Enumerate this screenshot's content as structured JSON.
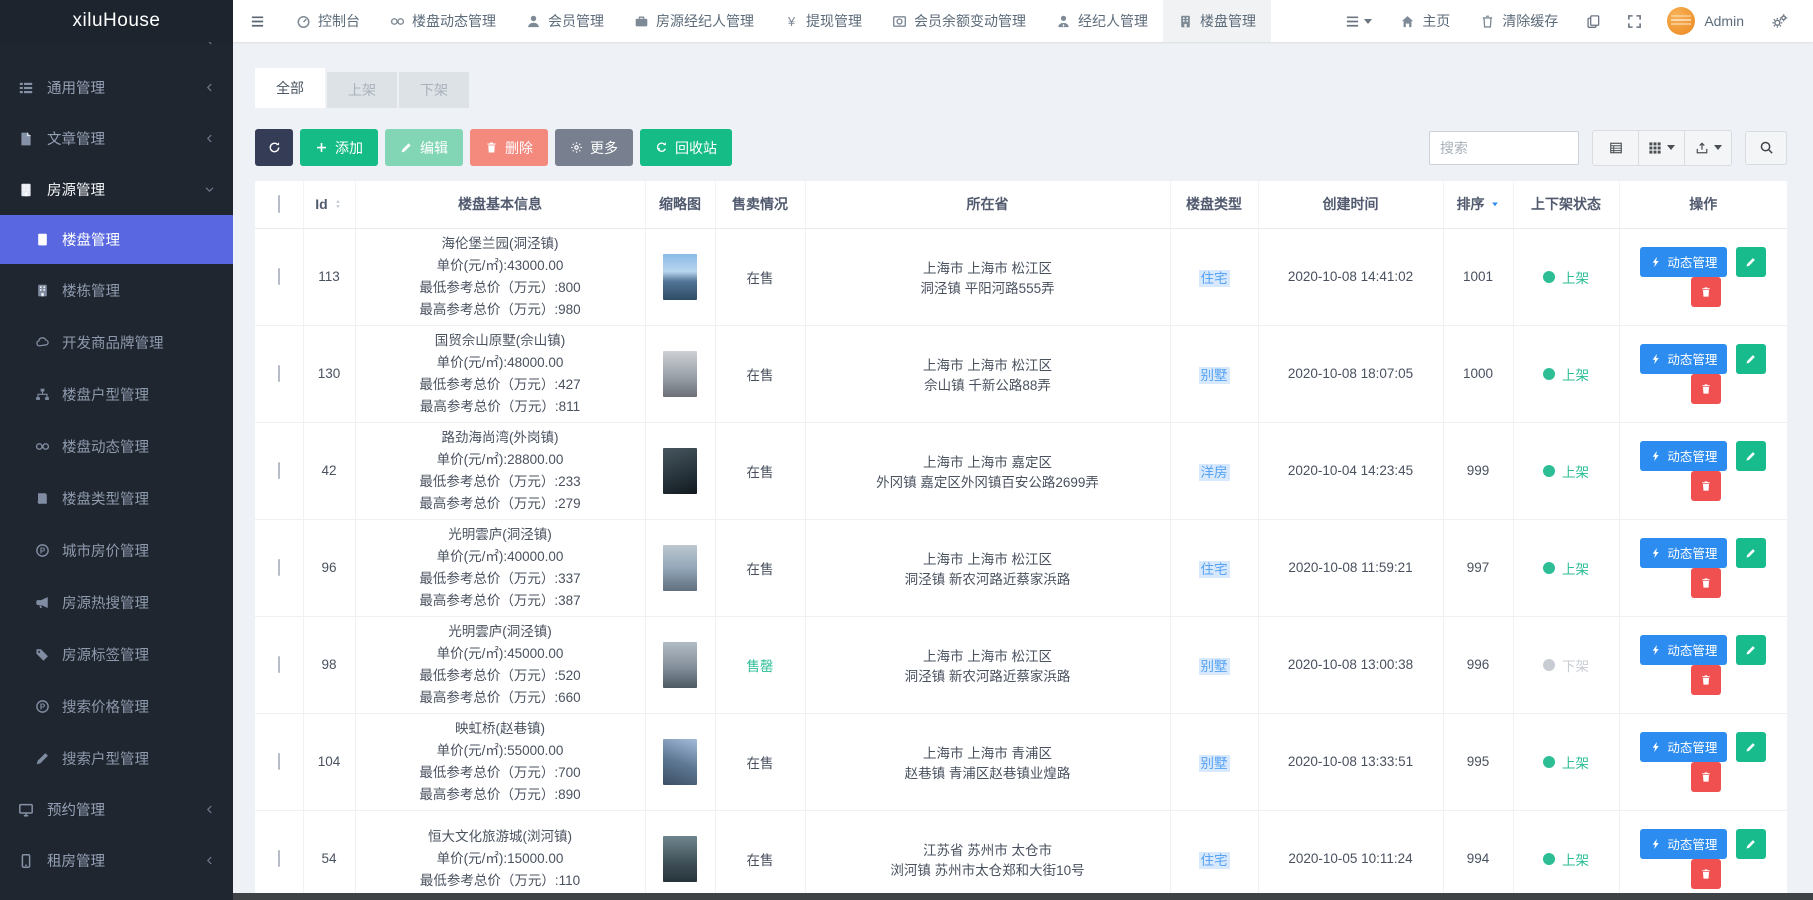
{
  "brand": "xiluHouse",
  "topnav": {
    "items": [
      {
        "label": "控制台",
        "icon": "gauge"
      },
      {
        "label": "楼盘动态管理",
        "icon": "binoc"
      },
      {
        "label": "会员管理",
        "icon": "user"
      },
      {
        "label": "房源经纪人管理",
        "icon": "briefcase"
      },
      {
        "label": "提现管理",
        "icon": "yen"
      },
      {
        "label": "会员余额变动管理",
        "icon": "balance"
      },
      {
        "label": "经纪人管理",
        "icon": "usertie"
      },
      {
        "label": "楼盘管理",
        "icon": "building",
        "active": true
      }
    ],
    "home_label": "主页",
    "clear_cache_label": "清除缓存",
    "admin_label": "Admin"
  },
  "sidebar": {
    "items": [
      {
        "label": "通用管理",
        "icon": "thlist",
        "type": "group"
      },
      {
        "label": "文章管理",
        "icon": "file",
        "type": "group"
      },
      {
        "label": "房源管理",
        "icon": "building",
        "type": "group",
        "expanded": true
      },
      {
        "label": "楼盘管理",
        "icon": "building",
        "type": "child",
        "active": true
      },
      {
        "label": "楼栋管理",
        "icon": "building",
        "type": "child"
      },
      {
        "label": "开发商品牌管理",
        "icon": "cloud",
        "type": "child"
      },
      {
        "label": "楼盘户型管理",
        "icon": "sitemap",
        "type": "child"
      },
      {
        "label": "楼盘动态管理",
        "icon": "binoc",
        "type": "child"
      },
      {
        "label": "楼盘类型管理",
        "icon": "book",
        "type": "child"
      },
      {
        "label": "城市房价管理",
        "icon": "pcircle",
        "type": "child"
      },
      {
        "label": "房源热搜管理",
        "icon": "bullhorn",
        "type": "child"
      },
      {
        "label": "房源标签管理",
        "icon": "tags",
        "type": "child"
      },
      {
        "label": "搜索价格管理",
        "icon": "pcircle",
        "type": "child"
      },
      {
        "label": "搜索户型管理",
        "icon": "pen",
        "type": "child"
      },
      {
        "label": "预约管理",
        "icon": "desktop",
        "type": "group"
      },
      {
        "label": "租房管理",
        "icon": "mobile",
        "type": "group"
      }
    ]
  },
  "tabs": [
    {
      "label": "全部",
      "active": true
    },
    {
      "label": "上架"
    },
    {
      "label": "下架"
    }
  ],
  "toolbar": {
    "add_label": "添加",
    "edit_label": "编辑",
    "delete_label": "删除",
    "more_label": "更多",
    "recycle_label": "回收站",
    "search_placeholder": "搜索"
  },
  "table": {
    "columns": [
      "Id",
      "楼盘基本信息",
      "缩略图",
      "售卖情况",
      "所在省",
      "楼盘类型",
      "创建时间",
      "排序",
      "上下架状态",
      "操作"
    ],
    "action_label": "动态管理",
    "rows": [
      {
        "id": "113",
        "name": "海伦堡兰园(洞泾镇)",
        "unit_price": "单价(元/㎡):43000.00",
        "min_price": "最低参考总价（万元）:800",
        "max_price": "最高参考总价（万元）:980",
        "sale": "在售",
        "sale_state": "normal",
        "province_line1": "上海市 上海市 松江区",
        "province_line2": "洞泾镇 平阳河路555弄",
        "type": "住宅",
        "created": "2020-10-08 14:41:02",
        "sort": "1001",
        "status": "上架",
        "status_state": "up",
        "thumb": "t1"
      },
      {
        "id": "130",
        "name": "国贸佘山原墅(佘山镇)",
        "unit_price": "单价(元/㎡):48000.00",
        "min_price": "最低参考总价（万元）:427",
        "max_price": "最高参考总价（万元）:811",
        "sale": "在售",
        "sale_state": "normal",
        "province_line1": "上海市 上海市 松江区",
        "province_line2": "佘山镇 千新公路88弄",
        "type": "别墅",
        "created": "2020-10-08 18:07:05",
        "sort": "1000",
        "status": "上架",
        "status_state": "up",
        "thumb": "t2"
      },
      {
        "id": "42",
        "name": "路劲海尚湾(外岗镇)",
        "unit_price": "单价(元/㎡):28800.00",
        "min_price": "最低参考总价（万元）:233",
        "max_price": "最高参考总价（万元）:279",
        "sale": "在售",
        "sale_state": "normal",
        "province_line1": "上海市 上海市 嘉定区",
        "province_line2": "外冈镇 嘉定区外冈镇百安公路2699弄",
        "type": "洋房",
        "created": "2020-10-04 14:23:45",
        "sort": "999",
        "status": "上架",
        "status_state": "up",
        "thumb": "t3"
      },
      {
        "id": "96",
        "name": "光明雲庐(洞泾镇)",
        "unit_price": "单价(元/㎡):40000.00",
        "min_price": "最低参考总价（万元）:337",
        "max_price": "最高参考总价（万元）:387",
        "sale": "在售",
        "sale_state": "normal",
        "province_line1": "上海市 上海市 松江区",
        "province_line2": "洞泾镇 新农河路近蔡家浜路",
        "type": "住宅",
        "created": "2020-10-08 11:59:21",
        "sort": "997",
        "status": "上架",
        "status_state": "up",
        "thumb": "t4"
      },
      {
        "id": "98",
        "name": "光明雲庐(洞泾镇)",
        "unit_price": "单价(元/㎡):45000.00",
        "min_price": "最低参考总价（万元）:520",
        "max_price": "最高参考总价（万元）:660",
        "sale": "售罄",
        "sale_state": "soldout",
        "province_line1": "上海市 上海市 松江区",
        "province_line2": "洞泾镇 新农河路近蔡家浜路",
        "type": "别墅",
        "created": "2020-10-08 13:00:38",
        "sort": "996",
        "status": "下架",
        "status_state": "down",
        "thumb": "t5"
      },
      {
        "id": "104",
        "name": "映虹桥(赵巷镇)",
        "unit_price": "单价(元/㎡):55000.00",
        "min_price": "最低参考总价（万元）:700",
        "max_price": "最高参考总价（万元）:890",
        "sale": "在售",
        "sale_state": "normal",
        "province_line1": "上海市 上海市 青浦区",
        "province_line2": "赵巷镇 青浦区赵巷镇业煌路",
        "type": "别墅",
        "created": "2020-10-08 13:33:51",
        "sort": "995",
        "status": "上架",
        "status_state": "up",
        "thumb": "t6"
      },
      {
        "id": "54",
        "name": "恒大文化旅游城(浏河镇)",
        "unit_price": "单价(元/㎡):15000.00",
        "min_price": "最低参考总价（万元）:110",
        "max_price": "",
        "sale": "在售",
        "sale_state": "normal",
        "province_line1": "江苏省 苏州市 太仓市",
        "province_line2": "浏河镇 苏州市太仓郑和大街10号",
        "type": "住宅",
        "created": "2020-10-05 10:11:24",
        "sort": "994",
        "status": "上架",
        "status_state": "up",
        "thumb": "t7"
      }
    ]
  },
  "colors": {
    "primary_blue": "#2d8cf0",
    "success_green": "#16bc85",
    "danger_red": "#f05050",
    "status_up": "#2dbe96",
    "status_down": "#c8cdd4",
    "sidebar_active": "#5968e0",
    "type_tag_blue": "#57a3f3"
  }
}
